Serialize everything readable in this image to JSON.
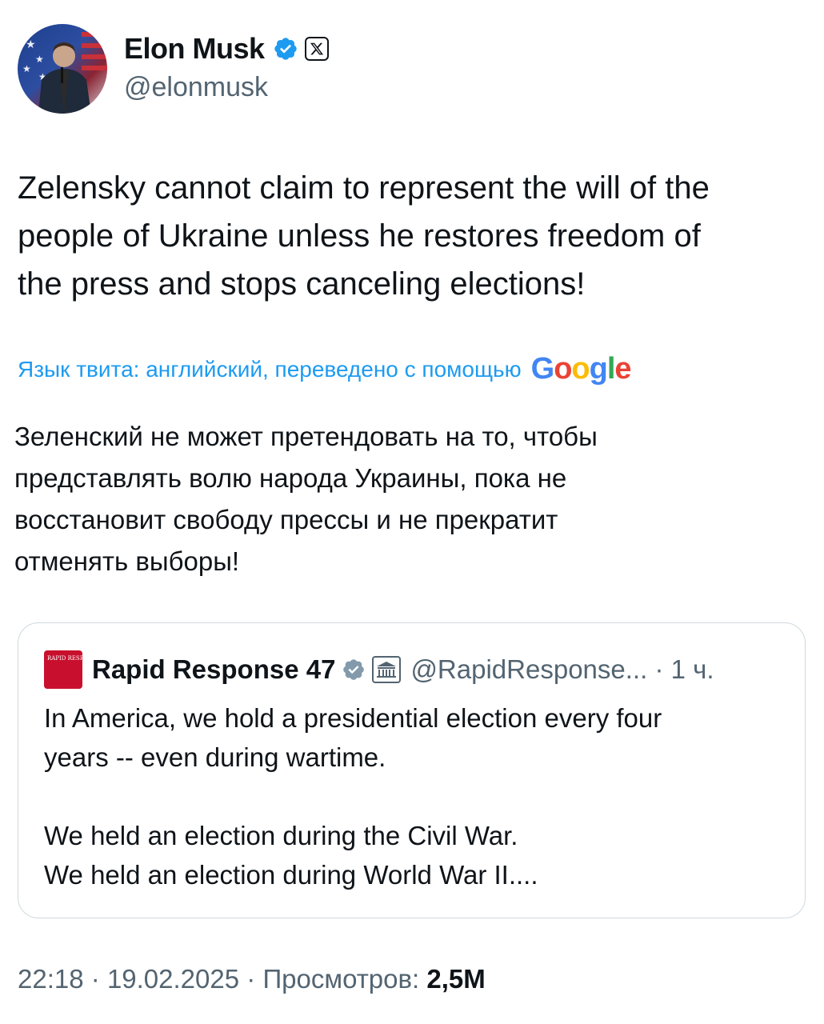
{
  "author": {
    "display_name": "Elon Musk",
    "handle": "@elonmusk",
    "verified_icon": "verified-badge-icon",
    "affiliate_icon": "x-logo-icon"
  },
  "tweet": {
    "text": "Zelensky cannot claim to represent the will of the\npeople of Ukraine unless he restores freedom of\nthe press and stops canceling elections!",
    "translation_note": "Язык твита: английский, переведено с помощью",
    "translation_provider": {
      "letters": [
        "G",
        "o",
        "o",
        "g",
        "l",
        "e"
      ]
    },
    "translated_text": "Зеленский не может претендовать на то, чтобы\nпредставлять волю народа Украины, пока не\nвосстановит свободу прессы и не прекратит\nотменять выборы!"
  },
  "quote": {
    "logo_text": "RAPID RESPONSE",
    "display_name": "Rapid Response 47",
    "handle": "@RapidResponse...",
    "time": "1 ч.",
    "separator": "·",
    "text": "In America, we hold a presidential election every four\nyears -- even during wartime.\n\nWe held an election during the Civil War.\nWe held an election during World War II...."
  },
  "footer": {
    "time": "22:18",
    "date": "19.02.2025",
    "separator": "·",
    "views_label": "Просмотров:",
    "views_count": "2,5M"
  },
  "colors": {
    "link": "#1d9bf0",
    "verified": "#1d9bf0",
    "gov_verified": "#829aab",
    "muted": "#536471",
    "text": "#0f1419",
    "rr_red": "#c8102e"
  }
}
